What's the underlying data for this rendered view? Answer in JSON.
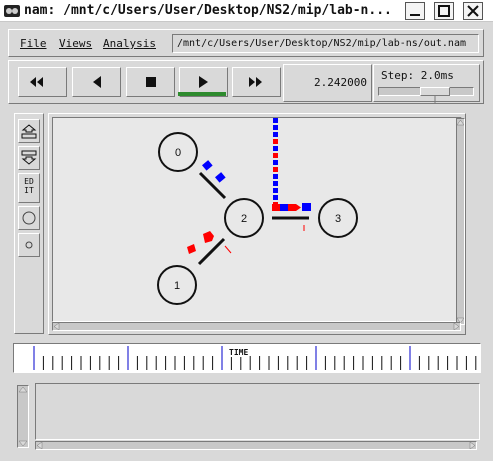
{
  "window": {
    "title": "nam: /mnt/c/Users/User/Desktop/NS2/mip/lab-n...",
    "controls": [
      "minimize",
      "maximize",
      "close"
    ]
  },
  "menu": {
    "file": "File",
    "views": "Views",
    "analysis": "Analysis",
    "file_path": "/mnt/c/Users/User/Desktop/NS2/mip/lab-ns/out.nam"
  },
  "playback": {
    "buttons": [
      "rewind-icon",
      "step-back-icon",
      "stop-icon",
      "play-icon",
      "fast-forward-icon"
    ],
    "active_button": "play",
    "current_time": "2.242000",
    "step_label": "Step: 2.0ms",
    "active_color": "#2e8b2e"
  },
  "toolbar": {
    "edit_label_top": "ED",
    "edit_label_bottom": "IT"
  },
  "network": {
    "nodes": [
      {
        "id": "node-0",
        "label": "0"
      },
      {
        "id": "node-1",
        "label": "1"
      },
      {
        "id": "node-2",
        "label": "2"
      },
      {
        "id": "node-3",
        "label": "3"
      }
    ],
    "links": [
      [
        "0",
        "2"
      ],
      [
        "1",
        "2"
      ],
      [
        "2",
        "3"
      ]
    ],
    "packet_colors": {
      "red": "#ff0000",
      "blue": "#0000ff"
    }
  },
  "timeline": {
    "marker_label": "TIME"
  }
}
